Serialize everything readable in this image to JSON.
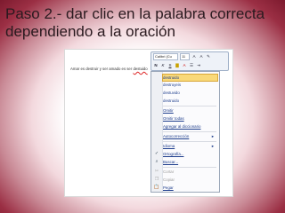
{
  "slide": {
    "title_line1": "Paso 2.- dar clic en la palabra correcta",
    "title_line2": "dependiendo a la oración"
  },
  "document": {
    "text_before": "Amar es destruir y ser amado es ser ",
    "misspelled_word": "destuido"
  },
  "toolbar": {
    "font": "Calibri (Cu",
    "size": "11",
    "grow_icon": "A",
    "shrink_icon": "A",
    "highlight_icon": "A",
    "bold": "N",
    "italic": "K",
    "underline": "S"
  },
  "context_menu": {
    "suggestions": [
      "destruido",
      "destruyeis",
      "destuvido",
      "destruido"
    ],
    "items": [
      {
        "label": "Omitir",
        "icon": ""
      },
      {
        "label": "Omitir todas",
        "icon": ""
      },
      {
        "label": "Agregar al diccionario",
        "icon": ""
      },
      {
        "label": "Autocorrección",
        "icon": "",
        "submenu": true
      },
      {
        "label": "Idioma",
        "icon": "",
        "submenu": true
      },
      {
        "label": "Ortografía...",
        "icon": "spellcheck-icon"
      },
      {
        "label": "Buscar...",
        "icon": "lookup-icon"
      },
      {
        "label": "Cortar",
        "icon": "cut-icon",
        "disabled": true
      },
      {
        "label": "Copiar",
        "icon": "copy-icon",
        "disabled": true
      },
      {
        "label": "Pegar",
        "icon": "paste-icon"
      }
    ]
  }
}
